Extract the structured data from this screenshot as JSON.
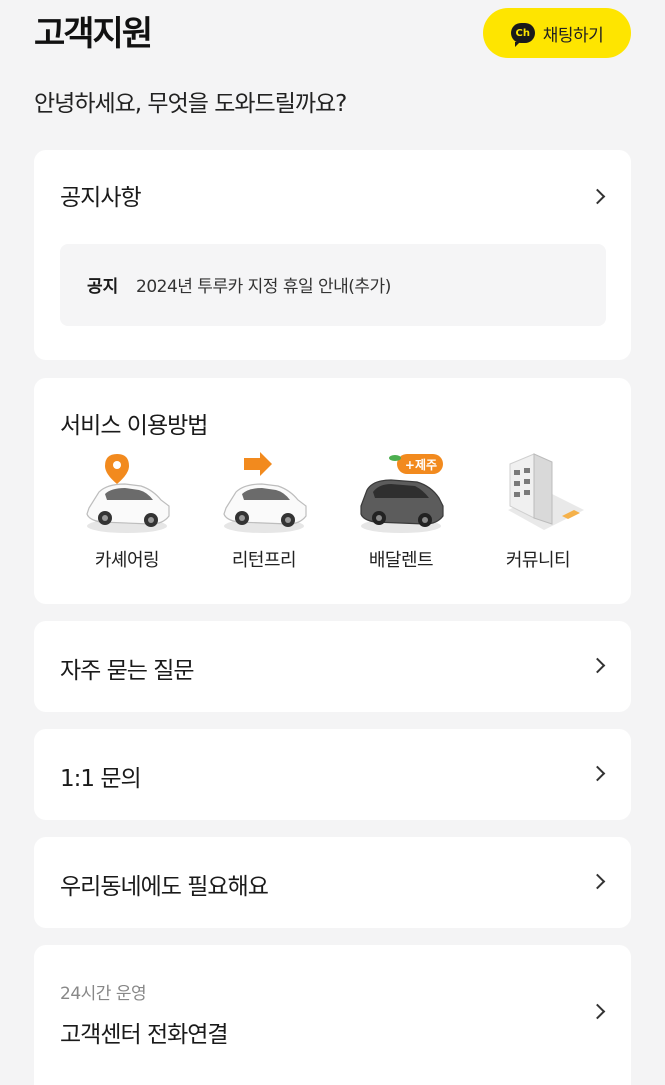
{
  "header": {
    "title": "고객지원",
    "chat_button": {
      "icon_text": "Ch",
      "label": "채팅하기"
    }
  },
  "greeting": "안녕하세요, 무엇을 도와드릴까요?",
  "notice": {
    "title": "공지사항",
    "item": {
      "tag": "공지",
      "text": "2024년 투루카 지정 휴일 안내(추가)"
    }
  },
  "services": {
    "title": "서비스 이용방법",
    "items": [
      {
        "label": "카셰어링",
        "icon": "car-location-pin-icon"
      },
      {
        "label": "리턴프리",
        "icon": "car-arrow-icon"
      },
      {
        "label": "배달렌트",
        "icon": "car-jeju-icon",
        "badge": "+제주"
      },
      {
        "label": "커뮤니티",
        "icon": "building-icon"
      }
    ]
  },
  "menu": {
    "faq": "자주 묻는 질문",
    "inquiry": "1:1 문의",
    "request": "우리동네에도 필요해요",
    "callcenter": {
      "sub": "24시간 운영",
      "label": "고객센터 전화연결"
    }
  },
  "colors": {
    "accent": "#fee500",
    "background": "#f4f4f5",
    "card": "#ffffff",
    "pin": "#f28a1e"
  }
}
